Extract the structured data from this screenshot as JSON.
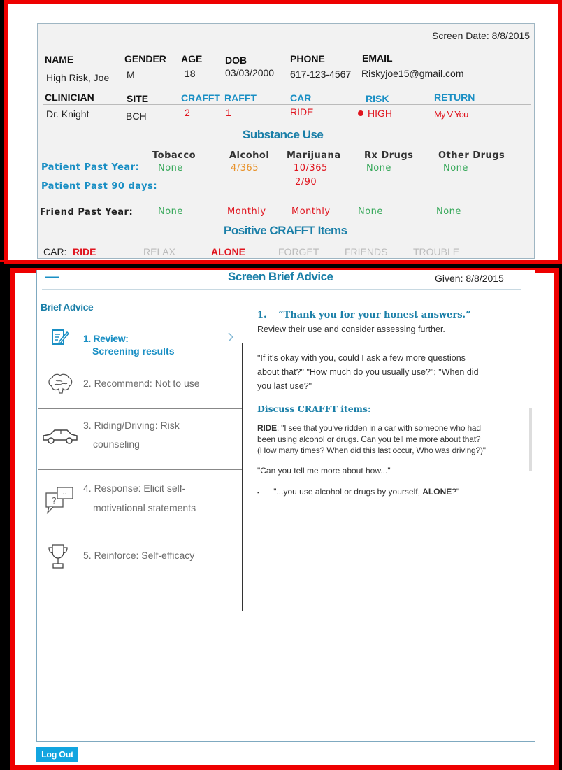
{
  "screen_date": "Screen Date: 8/8/2015",
  "patient_headers": [
    "NAME",
    "GENDER",
    "AGE",
    "DOB",
    "PHONE",
    "EMAIL"
  ],
  "patient_values": [
    "High Risk, Joe",
    "M",
    "18",
    "03/03/2000",
    "617-123-4567",
    "Riskyjoe15@gmail.com"
  ],
  "clinician_headers": [
    "CLINICIAN",
    "SITE",
    "CRAFFT",
    "RAFFT",
    "CAR",
    "RISK",
    "RETURN"
  ],
  "clinician_values": [
    "Dr. Knight",
    "BCH",
    "2",
    "1",
    "RIDE",
    "HIGH",
    "My V You"
  ],
  "substance_title": "Substance Use",
  "substance_columns": [
    "Tobacco",
    "Alcohol",
    "Marijuana",
    "Rx Drugs",
    "Other Drugs"
  ],
  "rows": {
    "past_year_label": "Patient Past Year:",
    "past_year_values": [
      "None",
      "4/365",
      "10/365",
      "None",
      "None"
    ],
    "past_90_label": "Patient Past 90 days:",
    "past_90_marijuana": "2/90",
    "friend_label": "Friend Past Year:",
    "friend_values": [
      "None",
      "Monthly",
      "Monthly",
      "None",
      "None"
    ]
  },
  "crafft_title": "Positive CRAFFT Items",
  "crafft_items": [
    "CAR:",
    "RIDE",
    "RELAX",
    "ALONE",
    "FORGET",
    "FRIENDS",
    "TROUBLE"
  ],
  "advice": {
    "collapse": "—",
    "title": "Screen Brief Advice",
    "given": "Given:  8/8/2015",
    "section_label": "Brief Advice",
    "steps": [
      {
        "line1": "1. Review:",
        "line2": "Screening results"
      },
      {
        "line1": "2. Recommend: Not to use",
        "line2": ""
      },
      {
        "line1": "3. Riding/Driving:  Risk",
        "line2": "counseling"
      },
      {
        "line1": "4. Response:  Elicit self-",
        "line2": "motivational  statements"
      },
      {
        "line1": "5. Reinforce:  Self-efficacy",
        "line2": ""
      }
    ],
    "content": {
      "heading_num": "1.",
      "heading": "“Thank you for your honest answers.”",
      "review_line": "Review  their use and consider assessing further.",
      "question_para": "\"If it's okay with you, could I ask a few more questions about that?\" \"How much do you usually use?\"; \"When did you last use?\"",
      "discuss": "Discuss  CRAFFT items:",
      "ride_label": "RIDE",
      "ride_text": ": \"I see that you've ridden in a car with someone who had been using alcohol or drugs. Can you tell me more about that? (How many times? When did this last occur, Who was driving?)\"",
      "tell_more": "\"Can you tell me more about how...\"",
      "bullet": "▪",
      "alone_pre": "\"...you use alcohol or drugs by yourself, ",
      "alone_word": "ALONE",
      "alone_post": "?\""
    }
  },
  "logout": "Log Out"
}
